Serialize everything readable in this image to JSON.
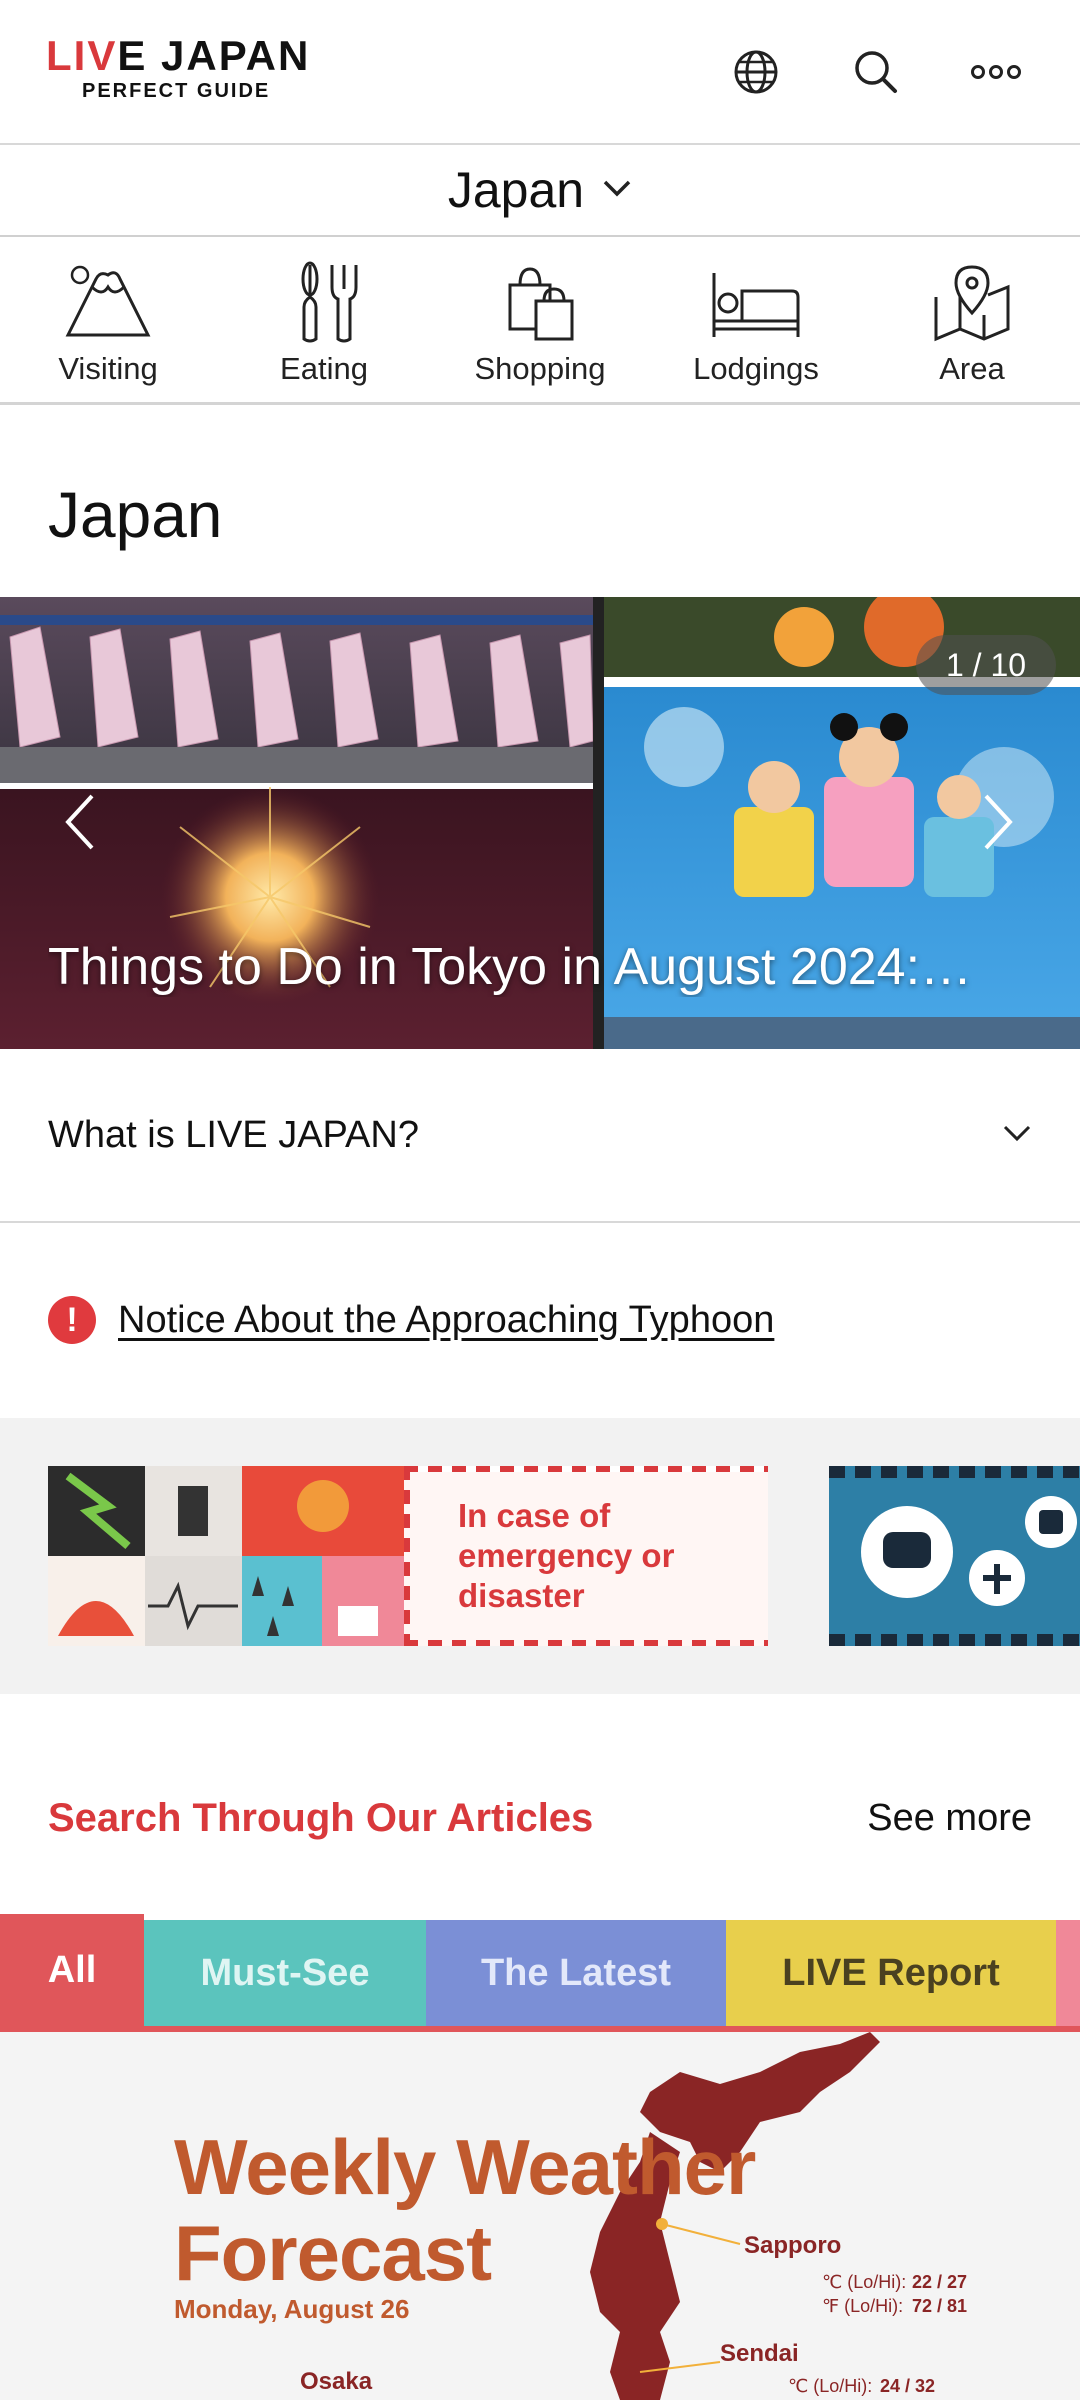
{
  "header": {
    "logo_top_a": "LI",
    "logo_top_v": "V",
    "logo_top_b": "E JAPAN",
    "logo_sub": "PERFECT GUIDE",
    "icons": [
      "globe-icon",
      "search-icon",
      "more-icon"
    ]
  },
  "region": {
    "name": "Japan"
  },
  "categories": [
    {
      "label": "Visiting",
      "icon": "mountain-icon"
    },
    {
      "label": "Eating",
      "icon": "utensils-icon"
    },
    {
      "label": "Shopping",
      "icon": "shopping-bag-icon"
    },
    {
      "label": "Lodgings",
      "icon": "bed-icon"
    },
    {
      "label": "Area",
      "icon": "map-icon"
    }
  ],
  "page": {
    "title": "Japan"
  },
  "carousel": {
    "caption": "Things to Do in Tokyo in August 2024:…",
    "counter": "1 / 10"
  },
  "about": {
    "label": "What is LIVE JAPAN?"
  },
  "notice": {
    "text": "Notice About the Approaching Typhoon"
  },
  "banner": {
    "line1": "In case of",
    "line2": "emergency or",
    "line3": "disaster"
  },
  "articles": {
    "title": "Search Through Our Articles",
    "see_more": "See more",
    "tabs": [
      {
        "label": "All",
        "color": "#e0565a",
        "text_color": "#ffffff"
      },
      {
        "label": "Must-See",
        "color": "#5bc4bd",
        "text_color": "#dff5f3"
      },
      {
        "label": "The Latest",
        "color": "#7b8fd6",
        "text_color": "#e3e8fa"
      },
      {
        "label": "LIVE Report",
        "color": "#e8cf4c",
        "text_color": "#4a4120"
      }
    ]
  },
  "weather": {
    "title_line1": "Weekly Weather",
    "title_line2": "Forecast",
    "date": "Monday, August 26",
    "cities": [
      {
        "name": "Sapporo",
        "c": "℃ (Lo/Hi):",
        "c_val": "22 / 27",
        "f": "℉ (Lo/Hi):",
        "f_val": "72 / 81"
      },
      {
        "name": "Sendai",
        "c": "℃ (Lo/Hi):",
        "c_val": "24 / 32"
      },
      {
        "name": "Osaka"
      }
    ]
  },
  "colors": {
    "accent_red": "#d9393c",
    "weather_orange": "#c05a2e",
    "weather_maroon": "#8a2525"
  }
}
